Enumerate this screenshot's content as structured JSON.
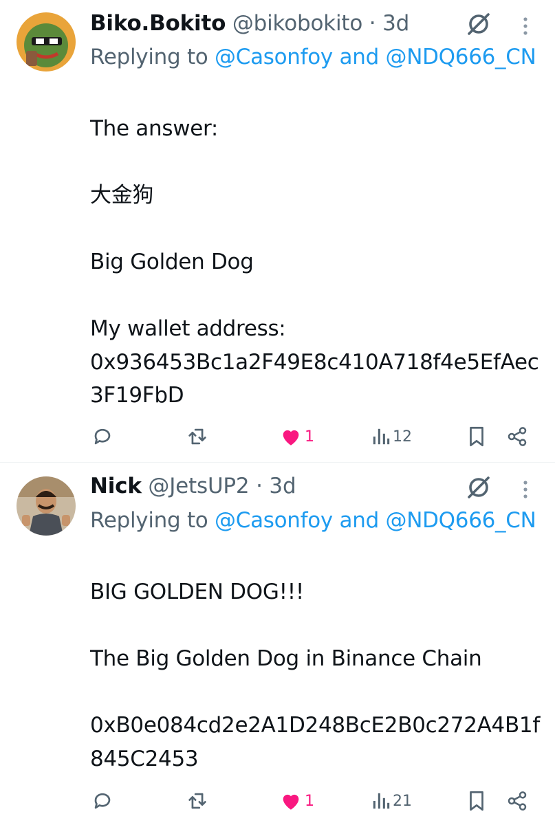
{
  "tweets": [
    {
      "display_name": "Biko.Bokito",
      "handle": "@bikobokito",
      "separator": "·",
      "age": "3d",
      "replying_prefix": "Replying to",
      "mention_1": "@Casonfoy",
      "and_word": "and",
      "mention_2": "@NDQ666_CN",
      "text": "The answer:\n\n大金狗\n\nBig Golden Dog\n\nMy wallet address:\n0x936453Bc1a2F49E8c410A718f4e5EfAec3F19FbD",
      "likes": "1",
      "views": "12",
      "avatar_icon": "pepe-avatar",
      "liked": true
    },
    {
      "display_name": "Nick",
      "handle": "@JetsUP2",
      "separator": "·",
      "age": "3d",
      "replying_prefix": "Replying to",
      "mention_1": "@Casonfoy",
      "and_word": "and",
      "mention_2": "@NDQ666_CN",
      "text": "BIG GOLDEN DOG!!!\n\nThe Big Golden Dog in Binance Chain\n\n0xB0e084cd2e2A1D248BcE2B0c272A4B1f845C2453",
      "likes": "1",
      "views": "21",
      "avatar_icon": "person-avatar",
      "liked": true
    }
  ],
  "colors": {
    "link": "#1d9bf0",
    "muted": "#536471",
    "like": "#f91880",
    "text": "#0f1419"
  },
  "icons": [
    "grok-icon",
    "more-icon",
    "reply-icon",
    "retweet-icon",
    "heart-icon",
    "views-icon",
    "bookmark-icon",
    "share-icon"
  ]
}
